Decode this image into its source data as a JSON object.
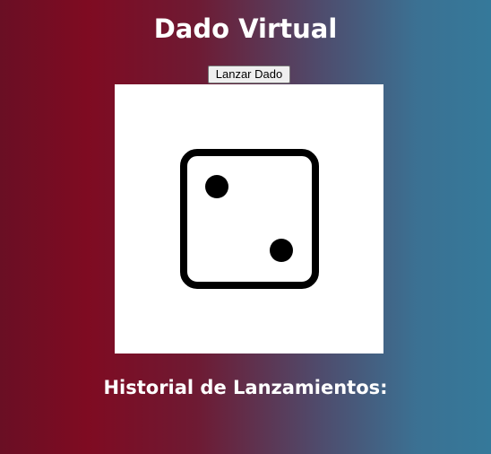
{
  "app": {
    "title": "Dado Virtual"
  },
  "controls": {
    "roll_button_label": "Lanzar Dado"
  },
  "dice": {
    "face_value": 2,
    "icon": "dice-two-icon"
  },
  "history": {
    "title": "Historial de Lanzamientos:",
    "items": []
  },
  "colors": {
    "gradient_left": "#6a0f24",
    "gradient_mid": "#7f0b22",
    "gradient_right": "#35799a",
    "text": "#ffffff",
    "dice_panel": "#ffffff",
    "dice_ink": "#000000"
  }
}
